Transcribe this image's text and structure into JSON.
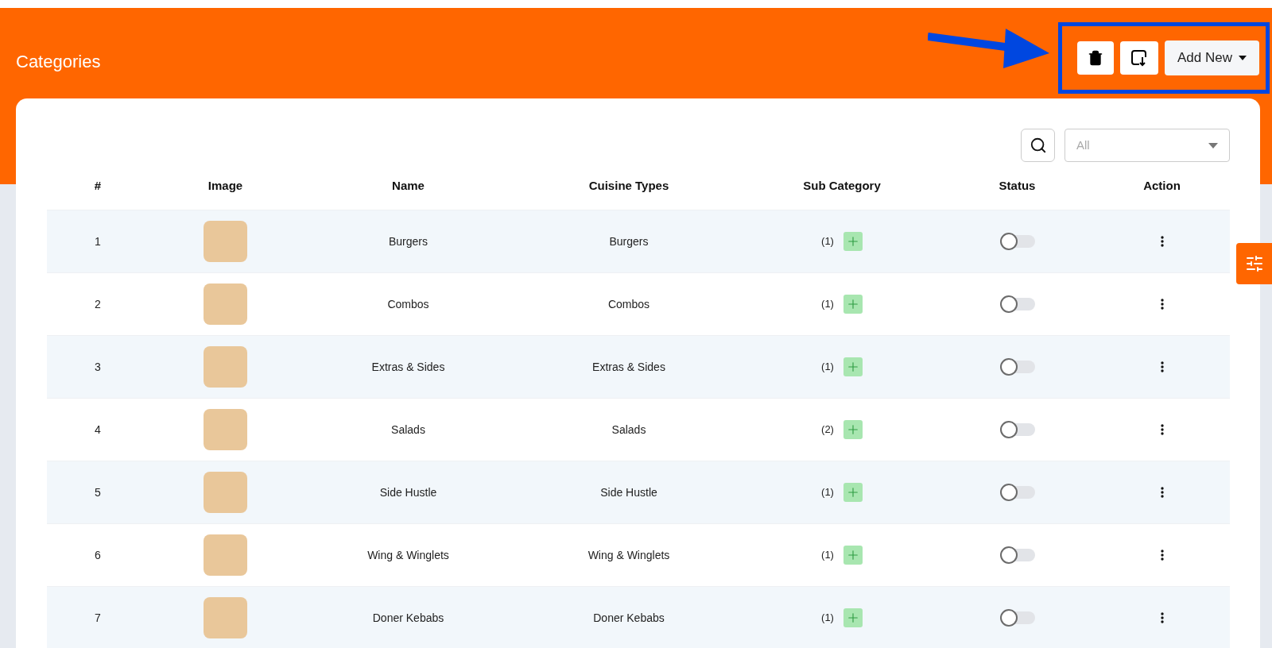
{
  "header": {
    "title": "Categories",
    "add_button": "Add New"
  },
  "filter": {
    "value": "All"
  },
  "table": {
    "columns": [
      "#",
      "Image",
      "Name",
      "Cuisine Types",
      "Sub Category",
      "Status",
      "Action"
    ],
    "rows": [
      {
        "index": "1",
        "name": "Burgers",
        "cuisine": "Burgers",
        "sub_count": "(1)",
        "on": false
      },
      {
        "index": "2",
        "name": "Combos",
        "cuisine": "Combos",
        "sub_count": "(1)",
        "on": false
      },
      {
        "index": "3",
        "name": "Extras & Sides",
        "cuisine": "Extras & Sides",
        "sub_count": "(1)",
        "on": false
      },
      {
        "index": "4",
        "name": "Salads",
        "cuisine": "Salads",
        "sub_count": "(2)",
        "on": false
      },
      {
        "index": "5",
        "name": "Side Hustle",
        "cuisine": "Side Hustle",
        "sub_count": "(1)",
        "on": false
      },
      {
        "index": "6",
        "name": "Wing & Winglets",
        "cuisine": "Wing & Winglets",
        "sub_count": "(1)",
        "on": false
      },
      {
        "index": "7",
        "name": "Doner Kebabs",
        "cuisine": "Doner Kebabs",
        "sub_count": "(1)",
        "on": false
      }
    ]
  }
}
